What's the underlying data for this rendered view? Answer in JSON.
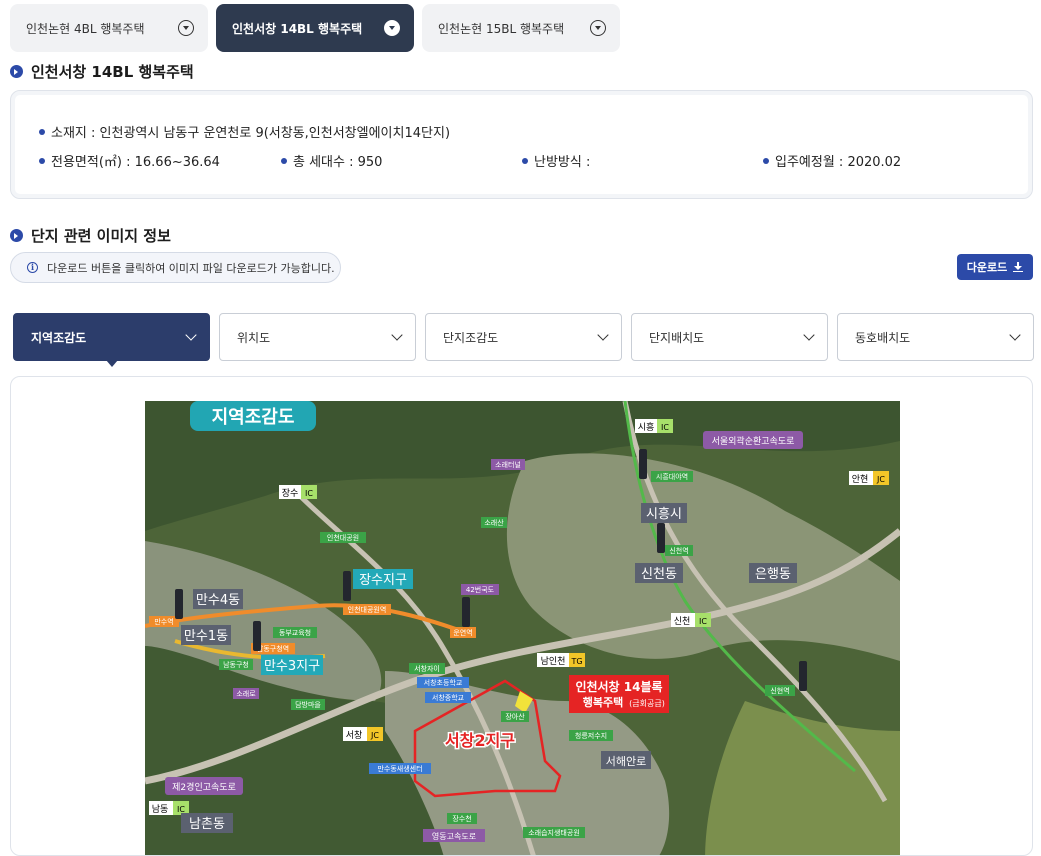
{
  "top_tabs": [
    {
      "label": "인천논현 4BL 행복주택"
    },
    {
      "label": "인천서창 14BL 행복주택"
    },
    {
      "label": "인천논현 15BL 행복주택"
    }
  ],
  "section1": {
    "title": "인천서창 14BL 행복주택"
  },
  "info": {
    "address": "소재지 : 인천광역시 남동구 운연천로 9(서창동,인천서창엘에이치14단지)",
    "area": "전용면적(㎡) : 16.66~36.64",
    "households": "총 세대수 : 950",
    "heating": "난방방식 :",
    "move_in": "입주예정월 : 2020.02"
  },
  "section2": {
    "title": "단지 관련 이미지 정보"
  },
  "notice": {
    "text": "다운로드 버튼을 클릭하여 이미지 파일 다운로드가 가능합니다."
  },
  "download_button": {
    "label": "다운로드"
  },
  "image_tabs": [
    {
      "label": "지역조감도"
    },
    {
      "label": "위치도"
    },
    {
      "label": "단지조감도"
    },
    {
      "label": "단지배치도"
    },
    {
      "label": "동호배치도"
    }
  ],
  "map": {
    "title": "지역조감도",
    "labels": {
      "jangsu_ic": "장수",
      "ic": "IC",
      "jc": "JC",
      "tg": "TG",
      "siheung_ic": "시흥",
      "anhyeon_jc": "안현",
      "sincheon_ic": "신천",
      "namincheon_tg": "남인천",
      "seochang_jc": "서창",
      "namdong_ic": "남동",
      "seoul_ring": "서울외곽순환고속도로",
      "second_gyeongin": "제2경인고속도로",
      "siheung_si": "시흥시",
      "sincheon_dong": "신천동",
      "eunhaeng_dong": "은행동",
      "jangsu_district": "장수지구",
      "mansu4": "만수4동",
      "mansu1": "만수1동",
      "mansu3": "만수3지구",
      "seochang2": "서창2지구",
      "namchon": "남촌동",
      "project_line1": "인천서창 14블록",
      "project_line2": "행복주택",
      "project_note": "(금회공급)",
      "seohaean_ro": "서해안로",
      "soraetil": "소래터널",
      "sorae_san": "소래산",
      "incheon_park": "인천대공원",
      "incheon_park_stn": "인천대공원역",
      "national_route": "42번국도",
      "unyeon_stn": "운연역",
      "mansu_stn": "만수역",
      "namdong_gucheong": "남동구청",
      "namdong_gucheong_stn": "남동구청역",
      "dongbu_edu": "동부교육청",
      "soraero": "소래로",
      "dambang": "담방마을",
      "seochang_xi": "서창자이",
      "seochang_elem": "서창초등학교",
      "seochang_mid": "서창중학교",
      "jangasan": "장아산",
      "cheongneung": "청릉저수지",
      "mansu_welfare": "만수동새생센터",
      "jangsu_stn": "장수천",
      "siheung_daeya": "시흥대야역",
      "sincheon_stn": "신천역",
      "sinhyeon_stn": "신현역",
      "yeongdong": "영동고속도로",
      "sorae_eco": "소래습지생태공원"
    }
  },
  "colors": {
    "accent": "#2c4aa8",
    "active_tab": "#2e3a4f",
    "active_select": "#2c3d6b"
  }
}
